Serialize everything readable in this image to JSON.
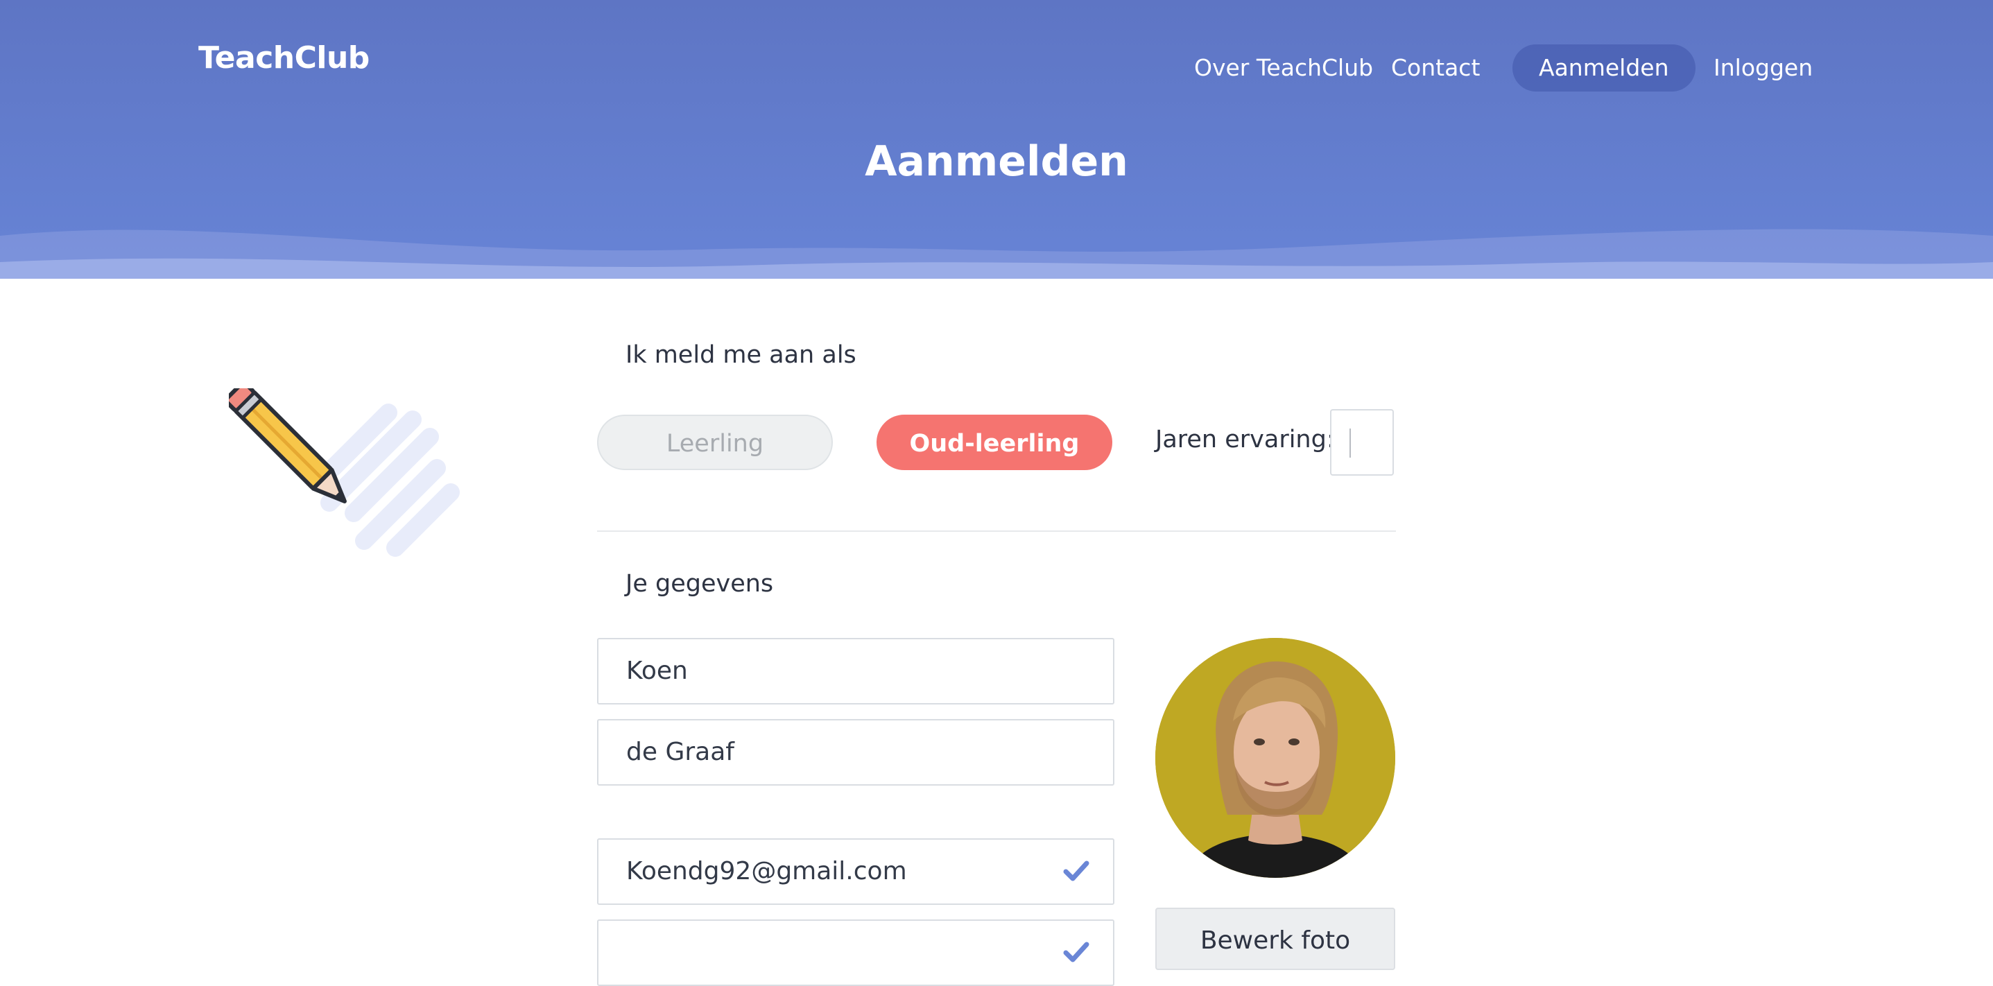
{
  "header": {
    "logo": "TeachClub",
    "nav": [
      {
        "label": "Over TeachClub"
      },
      {
        "label": "Contact"
      },
      {
        "label": "Aanmelden",
        "active": true
      },
      {
        "label": "Inloggen"
      }
    ],
    "page_title": "Aanmelden"
  },
  "signup_as": {
    "label": "Ik meld me aan als",
    "options": [
      "Leerling",
      "Oud-leerling"
    ],
    "selected": "Oud-leerling",
    "experience_label": "Jaren ervaring:",
    "experience_value": ""
  },
  "details": {
    "label": "Je gegevens",
    "first_name": "Koen",
    "last_name": "de Graaf",
    "email": "Koendg92@gmail.com",
    "email_valid": true,
    "edit_photo_label": "Bewerk foto"
  },
  "colors": {
    "header": "#6380d2",
    "accent_coral": "#f57470",
    "check_blue": "#6a86d6",
    "avatar_bg": "#bfa823"
  },
  "icons": [
    "pencil-icon",
    "check-icon"
  ]
}
